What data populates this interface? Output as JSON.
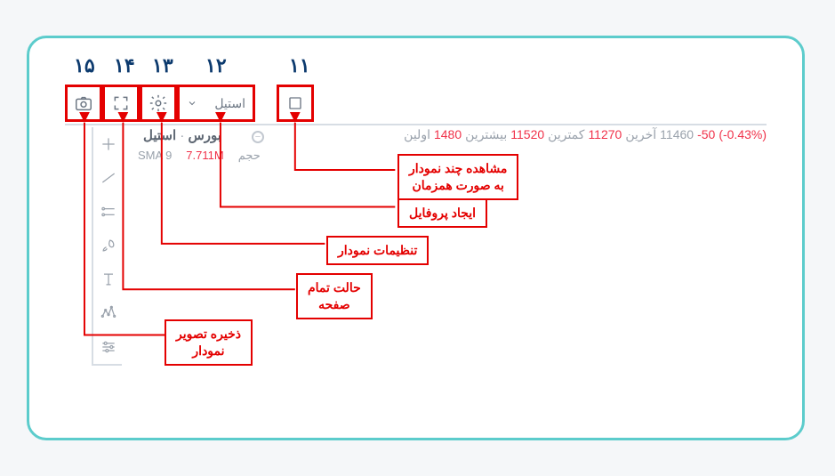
{
  "labels": {
    "n11": "۱۱",
    "n12": "۱۲",
    "n13": "۱۳",
    "n14": "۱۴",
    "n15": "۱۵"
  },
  "toolbar": {
    "style_label": "استیل"
  },
  "ticker": {
    "change_pct": "(-0.43%)",
    "change_abs": "-50",
    "val_a": "11460",
    "lbl_last": "آخرین",
    "val_last": "11270",
    "lbl_low": "کمترین",
    "val_low": "11520",
    "lbl_high": "بیشترین",
    "val_first": "1480",
    "lbl_first": "اولین",
    "name": "استیل",
    "dot": "·",
    "exchange": "بورس"
  },
  "sma": {
    "label": "SMA 9",
    "value": "7.711M",
    "vol": "حجم"
  },
  "callouts": {
    "c11": "مشاهده چند نمودار\nبه صورت همزمان",
    "c12": "ایجاد پروفایل",
    "c13": "تنظیمات نمودار",
    "c14": "حالت تمام\nصفحه",
    "c15": "ذخیره تصویر\nنمودار"
  }
}
